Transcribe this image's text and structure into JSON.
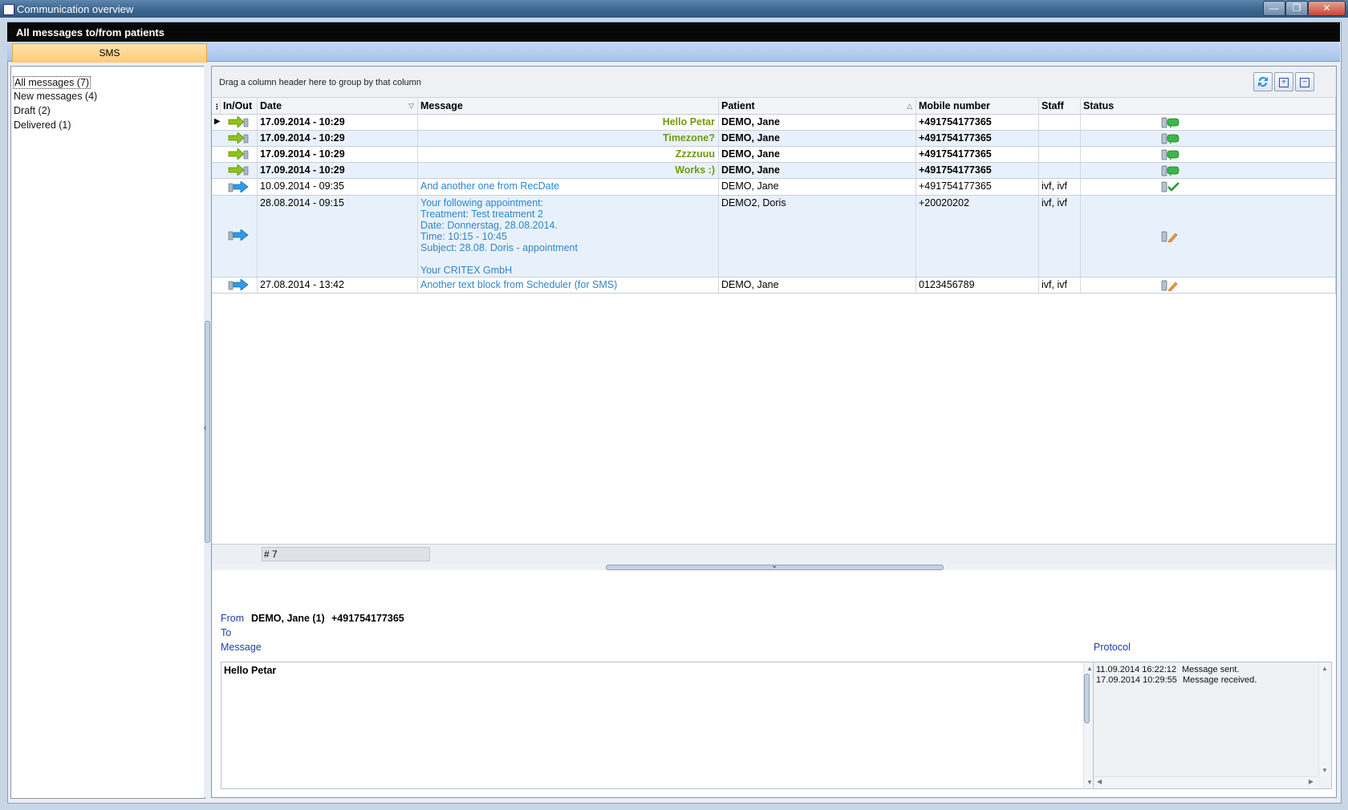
{
  "window": {
    "title": "Communication overview"
  },
  "header": {
    "title": "All messages to/from patients"
  },
  "tabs": [
    {
      "label": "SMS",
      "active": true
    }
  ],
  "folders": [
    {
      "label": "All messages (7)",
      "selected": true
    },
    {
      "label": "New messages (4)"
    },
    {
      "label": "Draft (2)"
    },
    {
      "label": "Delivered (1)"
    }
  ],
  "grid": {
    "group_hint": "Drag a column header here to group by that column",
    "columns": [
      "In/Out",
      "Date",
      "Message",
      "Patient",
      "Mobile number",
      "Staff",
      "Status"
    ],
    "rows": [
      {
        "direction": "in",
        "date": "17.09.2014 - 10:29",
        "message": "Hello Petar",
        "patient": "DEMO, Jane",
        "mobile": "+491754177365",
        "staff": "",
        "status": "received-new",
        "bold": true
      },
      {
        "direction": "in",
        "date": "17.09.2014 - 10:29",
        "message": "Timezone?",
        "patient": "DEMO, Jane",
        "mobile": "+491754177365",
        "staff": "",
        "status": "received-new",
        "bold": true
      },
      {
        "direction": "in",
        "date": "17.09.2014 - 10:29",
        "message": "Zzzzuuu",
        "patient": "DEMO, Jane",
        "mobile": "+491754177365",
        "staff": "",
        "status": "received-new",
        "bold": true
      },
      {
        "direction": "in",
        "date": "17.09.2014 - 10:29",
        "message": "Works :)",
        "patient": "DEMO, Jane",
        "mobile": "+491754177365",
        "staff": "",
        "status": "received-new",
        "bold": true
      },
      {
        "direction": "out",
        "date": "10.09.2014 - 09:35",
        "message": "And another one from RecDate",
        "patient": "DEMO, Jane",
        "mobile": "+491754177365",
        "staff": "ivf, ivf",
        "status": "delivered",
        "bold": false
      },
      {
        "direction": "out",
        "date": "28.08.2014 - 09:15",
        "message": "Your following appointment:\nTreatment: Test treatment 2\nDate: Donnerstag, 28.08.2014.\nTime: 10:15 - 10:45\nSubject: 28.08. Doris - appointment\n\nYour CRITEX GmbH",
        "patient": "DEMO2, Doris",
        "mobile": "+20020202",
        "staff": "ivf, ivf",
        "status": "draft",
        "bold": false
      },
      {
        "direction": "out",
        "date": "27.08.2014 - 13:42",
        "message": "Another text block from Scheduler (for SMS)",
        "patient": "DEMO, Jane",
        "mobile": "0123456789",
        "staff": "ivf, ivf",
        "status": "draft",
        "bold": false
      }
    ],
    "footer_count": "# 7"
  },
  "detail": {
    "from_label": "From",
    "from_name": "DEMO, Jane (1)",
    "from_number": "+491754177365",
    "to_label": "To",
    "message_label": "Message",
    "message_text": "Hello Petar",
    "protocol_label": "Protocol",
    "protocol": [
      {
        "time": "11.09.2014 16:22:12",
        "event": "Message sent."
      },
      {
        "time": "17.09.2014 10:29:55",
        "event": "Message received."
      }
    ]
  },
  "colors": {
    "incoming_text": "#6e9a12",
    "outgoing_text": "#2e86c8",
    "tab_active": "#ffca78",
    "label_blue": "#1f3ea8"
  },
  "icons": {
    "refresh": "refresh-icon",
    "expand": "expand-all-icon",
    "collapse": "collapse-all-icon",
    "incoming": "incoming-arrow-icon",
    "outgoing": "outgoing-arrow-icon",
    "status_new": "phone-speech-bubble-icon",
    "status_delivered": "phone-checkmark-icon",
    "status_draft": "phone-pencil-icon"
  }
}
